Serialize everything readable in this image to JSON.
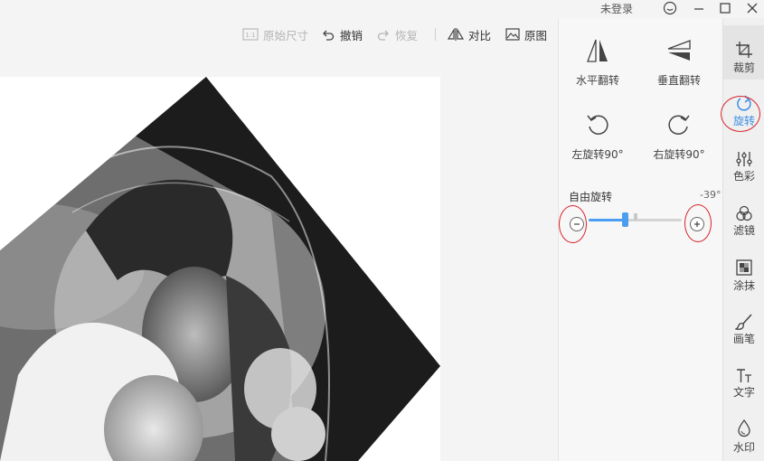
{
  "titlebar": {
    "login_status": "未登录",
    "icons": [
      "feedback-icon",
      "minimize-icon",
      "maximize-icon",
      "close-icon"
    ]
  },
  "toolbar": {
    "original_size": "原始尺寸",
    "undo": "撤销",
    "redo": "恢复",
    "compare": "对比",
    "original_image": "原图"
  },
  "rotate_panel": {
    "flip_horizontal": "水平翻转",
    "flip_vertical": "垂直翻转",
    "rotate_left": "左旋转90°",
    "rotate_right": "右旋转90°",
    "free_rotate_label": "自由旋转",
    "free_rotate_value": "-39°",
    "slider": {
      "min": -180,
      "max": 180,
      "value": -39
    }
  },
  "sidenav": {
    "crop": "裁剪",
    "rotate": "旋转",
    "color": "色彩",
    "filter": "滤镜",
    "smear": "涂抹",
    "brush": "画笔",
    "text": "文字",
    "watermark": "水印"
  },
  "colors": {
    "accent": "#4b9ef0",
    "highlight_ring": "#d8232a"
  }
}
